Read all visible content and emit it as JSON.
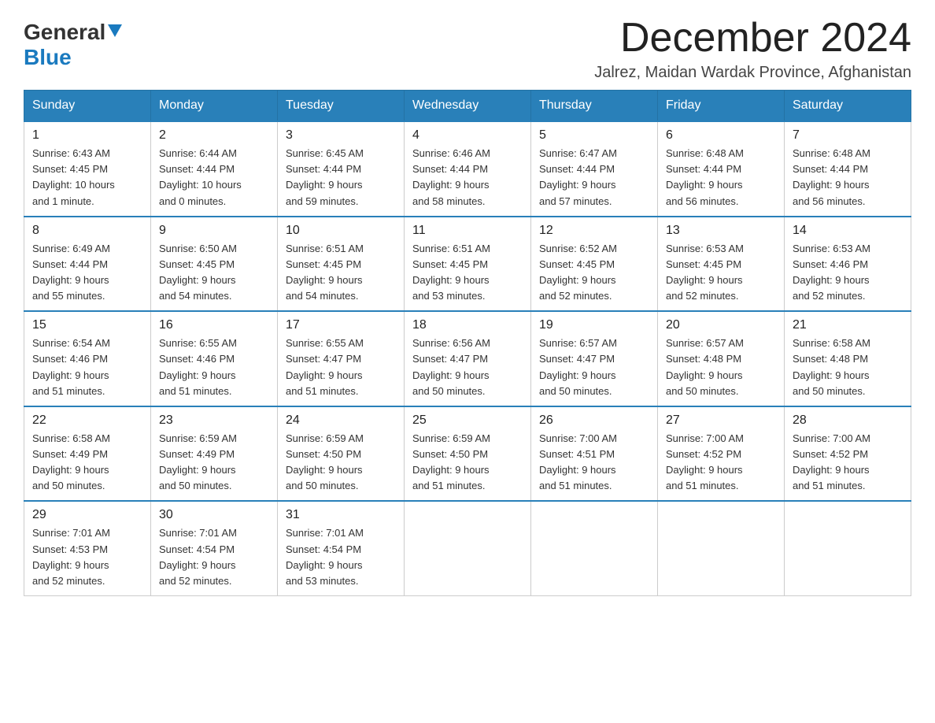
{
  "header": {
    "logo_general": "General",
    "logo_blue": "Blue",
    "month_title": "December 2024",
    "location": "Jalrez, Maidan Wardak Province, Afghanistan"
  },
  "days_of_week": [
    "Sunday",
    "Monday",
    "Tuesday",
    "Wednesday",
    "Thursday",
    "Friday",
    "Saturday"
  ],
  "weeks": [
    [
      {
        "date": "1",
        "sunrise": "6:43 AM",
        "sunset": "4:45 PM",
        "daylight": "10 hours and 1 minute."
      },
      {
        "date": "2",
        "sunrise": "6:44 AM",
        "sunset": "4:44 PM",
        "daylight": "10 hours and 0 minutes."
      },
      {
        "date": "3",
        "sunrise": "6:45 AM",
        "sunset": "4:44 PM",
        "daylight": "9 hours and 59 minutes."
      },
      {
        "date": "4",
        "sunrise": "6:46 AM",
        "sunset": "4:44 PM",
        "daylight": "9 hours and 58 minutes."
      },
      {
        "date": "5",
        "sunrise": "6:47 AM",
        "sunset": "4:44 PM",
        "daylight": "9 hours and 57 minutes."
      },
      {
        "date": "6",
        "sunrise": "6:48 AM",
        "sunset": "4:44 PM",
        "daylight": "9 hours and 56 minutes."
      },
      {
        "date": "7",
        "sunrise": "6:48 AM",
        "sunset": "4:44 PM",
        "daylight": "9 hours and 56 minutes."
      }
    ],
    [
      {
        "date": "8",
        "sunrise": "6:49 AM",
        "sunset": "4:44 PM",
        "daylight": "9 hours and 55 minutes."
      },
      {
        "date": "9",
        "sunrise": "6:50 AM",
        "sunset": "4:45 PM",
        "daylight": "9 hours and 54 minutes."
      },
      {
        "date": "10",
        "sunrise": "6:51 AM",
        "sunset": "4:45 PM",
        "daylight": "9 hours and 54 minutes."
      },
      {
        "date": "11",
        "sunrise": "6:51 AM",
        "sunset": "4:45 PM",
        "daylight": "9 hours and 53 minutes."
      },
      {
        "date": "12",
        "sunrise": "6:52 AM",
        "sunset": "4:45 PM",
        "daylight": "9 hours and 52 minutes."
      },
      {
        "date": "13",
        "sunrise": "6:53 AM",
        "sunset": "4:45 PM",
        "daylight": "9 hours and 52 minutes."
      },
      {
        "date": "14",
        "sunrise": "6:53 AM",
        "sunset": "4:46 PM",
        "daylight": "9 hours and 52 minutes."
      }
    ],
    [
      {
        "date": "15",
        "sunrise": "6:54 AM",
        "sunset": "4:46 PM",
        "daylight": "9 hours and 51 minutes."
      },
      {
        "date": "16",
        "sunrise": "6:55 AM",
        "sunset": "4:46 PM",
        "daylight": "9 hours and 51 minutes."
      },
      {
        "date": "17",
        "sunrise": "6:55 AM",
        "sunset": "4:47 PM",
        "daylight": "9 hours and 51 minutes."
      },
      {
        "date": "18",
        "sunrise": "6:56 AM",
        "sunset": "4:47 PM",
        "daylight": "9 hours and 50 minutes."
      },
      {
        "date": "19",
        "sunrise": "6:57 AM",
        "sunset": "4:47 PM",
        "daylight": "9 hours and 50 minutes."
      },
      {
        "date": "20",
        "sunrise": "6:57 AM",
        "sunset": "4:48 PM",
        "daylight": "9 hours and 50 minutes."
      },
      {
        "date": "21",
        "sunrise": "6:58 AM",
        "sunset": "4:48 PM",
        "daylight": "9 hours and 50 minutes."
      }
    ],
    [
      {
        "date": "22",
        "sunrise": "6:58 AM",
        "sunset": "4:49 PM",
        "daylight": "9 hours and 50 minutes."
      },
      {
        "date": "23",
        "sunrise": "6:59 AM",
        "sunset": "4:49 PM",
        "daylight": "9 hours and 50 minutes."
      },
      {
        "date": "24",
        "sunrise": "6:59 AM",
        "sunset": "4:50 PM",
        "daylight": "9 hours and 50 minutes."
      },
      {
        "date": "25",
        "sunrise": "6:59 AM",
        "sunset": "4:50 PM",
        "daylight": "9 hours and 51 minutes."
      },
      {
        "date": "26",
        "sunrise": "7:00 AM",
        "sunset": "4:51 PM",
        "daylight": "9 hours and 51 minutes."
      },
      {
        "date": "27",
        "sunrise": "7:00 AM",
        "sunset": "4:52 PM",
        "daylight": "9 hours and 51 minutes."
      },
      {
        "date": "28",
        "sunrise": "7:00 AM",
        "sunset": "4:52 PM",
        "daylight": "9 hours and 51 minutes."
      }
    ],
    [
      {
        "date": "29",
        "sunrise": "7:01 AM",
        "sunset": "4:53 PM",
        "daylight": "9 hours and 52 minutes."
      },
      {
        "date": "30",
        "sunrise": "7:01 AM",
        "sunset": "4:54 PM",
        "daylight": "9 hours and 52 minutes."
      },
      {
        "date": "31",
        "sunrise": "7:01 AM",
        "sunset": "4:54 PM",
        "daylight": "9 hours and 53 minutes."
      },
      {
        "date": "",
        "sunrise": "",
        "sunset": "",
        "daylight": ""
      },
      {
        "date": "",
        "sunrise": "",
        "sunset": "",
        "daylight": ""
      },
      {
        "date": "",
        "sunrise": "",
        "sunset": "",
        "daylight": ""
      },
      {
        "date": "",
        "sunrise": "",
        "sunset": "",
        "daylight": ""
      }
    ]
  ],
  "labels": {
    "sunrise": "Sunrise:",
    "sunset": "Sunset:",
    "daylight": "Daylight:"
  }
}
